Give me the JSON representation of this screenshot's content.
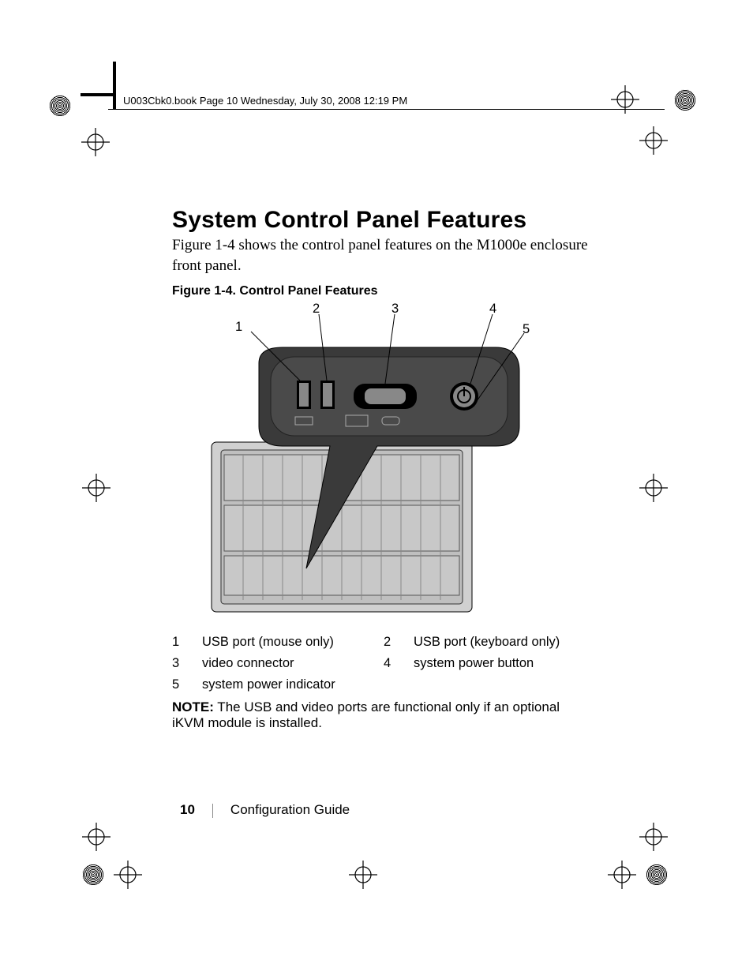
{
  "running_header": "U003Cbk0.book  Page 10  Wednesday, July 30, 2008  12:19 PM",
  "heading": "System Control Panel Features",
  "intro": "Figure 1-4 shows the control panel features on the M1000e enclosure front panel.",
  "figure_caption": "Figure 1-4.    Control Panel Features",
  "callouts": {
    "c1": "1",
    "c2": "2",
    "c3": "3",
    "c4": "4",
    "c5": "5"
  },
  "legend": {
    "r1n": "1",
    "r1t": "USB port (mouse only)",
    "r2n": "2",
    "r2t": "USB port (keyboard only)",
    "r3n": "3",
    "r3t": "video connector",
    "r4n": "4",
    "r4t": "system power button",
    "r5n": "5",
    "r5t": "system power indicator"
  },
  "note_label": "NOTE:",
  "note_body": " The USB and video ports are functional only if an optional iKVM module is installed.",
  "page_number": "10",
  "section": "Configuration Guide"
}
